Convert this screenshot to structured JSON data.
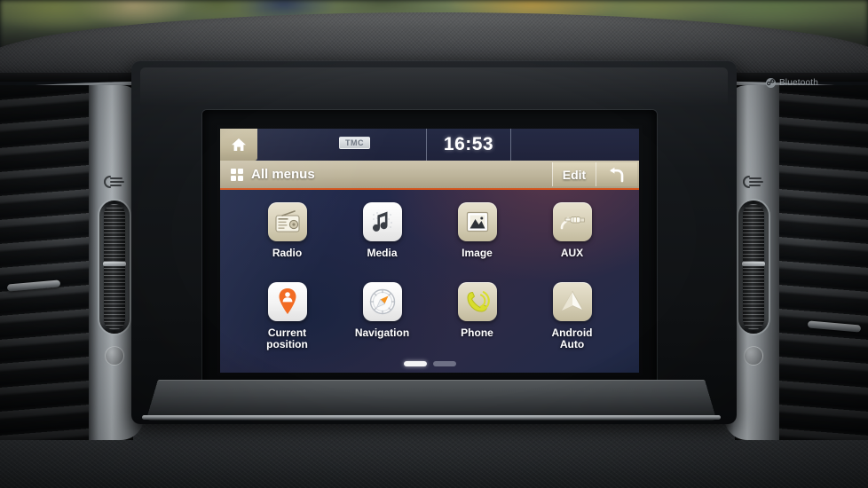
{
  "device": {
    "brand_badge": "Bluetooth",
    "badge_icon": "bluetooth-icon"
  },
  "screen": {
    "status_bar": {
      "home_icon": "home-icon",
      "tmc_label": "TMC",
      "clock": "16:53"
    },
    "title_bar": {
      "grid_icon": "grid-icon",
      "title": "All menus",
      "edit_label": "Edit",
      "back_icon": "back-arrow-icon"
    },
    "apps": [
      {
        "label": "Radio",
        "icon": "radio-icon",
        "tile": "tan"
      },
      {
        "label": "Media",
        "icon": "music-note-icon",
        "tile": "white"
      },
      {
        "label": "Image",
        "icon": "image-picture-icon",
        "tile": "tan"
      },
      {
        "label": "AUX",
        "icon": "aux-cable-icon",
        "tile": "tan"
      },
      {
        "label": "Current\nposition",
        "icon": "map-pin-person-icon",
        "tile": "white"
      },
      {
        "label": "Navigation",
        "icon": "compass-icon",
        "tile": "white"
      },
      {
        "label": "Phone",
        "icon": "phone-handset-icon",
        "tile": "tan"
      },
      {
        "label": "Android\nAuto",
        "icon": "android-auto-arrow-icon",
        "tile": "tan"
      }
    ],
    "pagination": {
      "total_pages": 2,
      "current_page": 1
    },
    "colors": {
      "title_bar_bg": "#bdb49a",
      "accent_underline": "#d4561f",
      "screen_bg_top_right_glow": "#58364a",
      "screen_bg_base": "#23294a",
      "label_text": "#ffffff"
    }
  },
  "dashboard": {
    "left_vent": {
      "airflow_icon": "airflow-icon",
      "thumbwheel": "vent-thumbwheel",
      "round_button": "vent-round-button"
    },
    "right_vent": {
      "airflow_icon": "airflow-icon",
      "thumbwheel": "vent-thumbwheel",
      "round_button": "vent-round-button"
    }
  }
}
